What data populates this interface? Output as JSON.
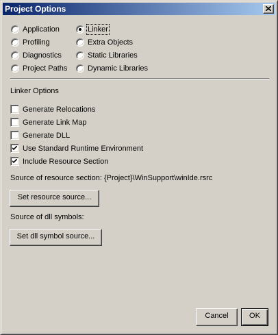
{
  "window": {
    "title": "Project Options",
    "close_icon": "close-icon"
  },
  "categories": {
    "selected": "Linker",
    "left_column": [
      {
        "label": "Application",
        "selected": false
      },
      {
        "label": "Profiling",
        "selected": false
      },
      {
        "label": "Diagnostics",
        "selected": false
      },
      {
        "label": "Project Paths",
        "selected": false
      }
    ],
    "right_column": [
      {
        "label": "Linker",
        "selected": true
      },
      {
        "label": "Extra Objects",
        "selected": false
      },
      {
        "label": "Static Libraries",
        "selected": false
      },
      {
        "label": "Dynamic Libraries",
        "selected": false
      }
    ]
  },
  "linker": {
    "section_title": "Linker Options",
    "options": [
      {
        "label": "Generate Relocations",
        "checked": false
      },
      {
        "label": "Generate Link Map",
        "checked": false
      },
      {
        "label": "Generate DLL",
        "checked": false
      },
      {
        "label": "Use Standard Runtime Environment",
        "checked": true
      },
      {
        "label": "Include Resource Section",
        "checked": true
      }
    ],
    "resource_source_text": "Source of resource section: {Project}\\WinSupport\\winIde.rsrc",
    "set_resource_button": "Set resource source...",
    "dll_symbols_text": "Source of dll symbols:",
    "set_dll_button": "Set dll symbol source..."
  },
  "footer": {
    "cancel_label": "Cancel",
    "ok_label": "OK"
  },
  "colors": {
    "face": "#d4d0c8",
    "title_start": "#0a246a",
    "title_end": "#a6caf0"
  }
}
